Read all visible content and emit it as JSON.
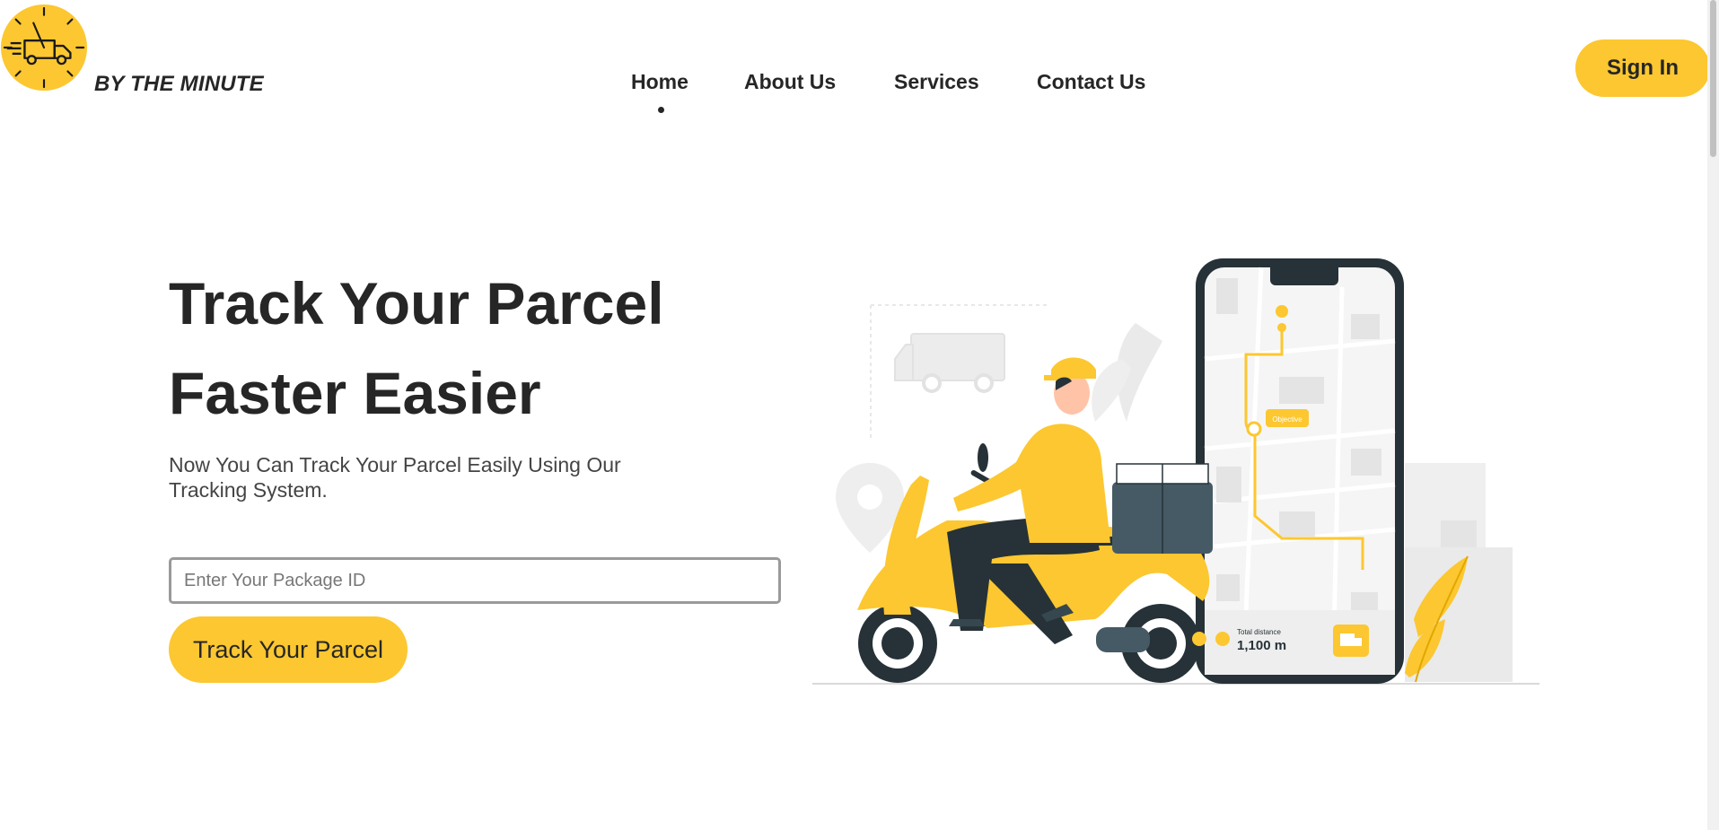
{
  "brand": {
    "name": "BY THE MINUTE",
    "logo_icon": "clock-truck-icon",
    "logo_color": "#fcc730"
  },
  "nav": {
    "items": [
      {
        "label": "Home",
        "active": true
      },
      {
        "label": "About Us",
        "active": false
      },
      {
        "label": "Services",
        "active": false
      },
      {
        "label": "Contact Us",
        "active": false
      }
    ]
  },
  "header": {
    "sign_in_label": "Sign In"
  },
  "hero": {
    "title_line1": "Track Your Parcel",
    "title_line2": "Faster Easier",
    "subtitle": "Now You Can Track Your Parcel Easily Using Our Tracking System.",
    "input_placeholder": "Enter Your Package ID",
    "button_label": "Track Your Parcel"
  },
  "illustration": {
    "phone": {
      "label_pin": "Objective",
      "distance_label": "Total distance",
      "distance_value": "1,100 m"
    },
    "icons": [
      "delivery-scooter-icon",
      "smartphone-map-icon",
      "truck-icon",
      "location-pin-icon"
    ]
  },
  "colors": {
    "accent": "#fcc730",
    "text": "#262626",
    "dark": "#263238"
  }
}
